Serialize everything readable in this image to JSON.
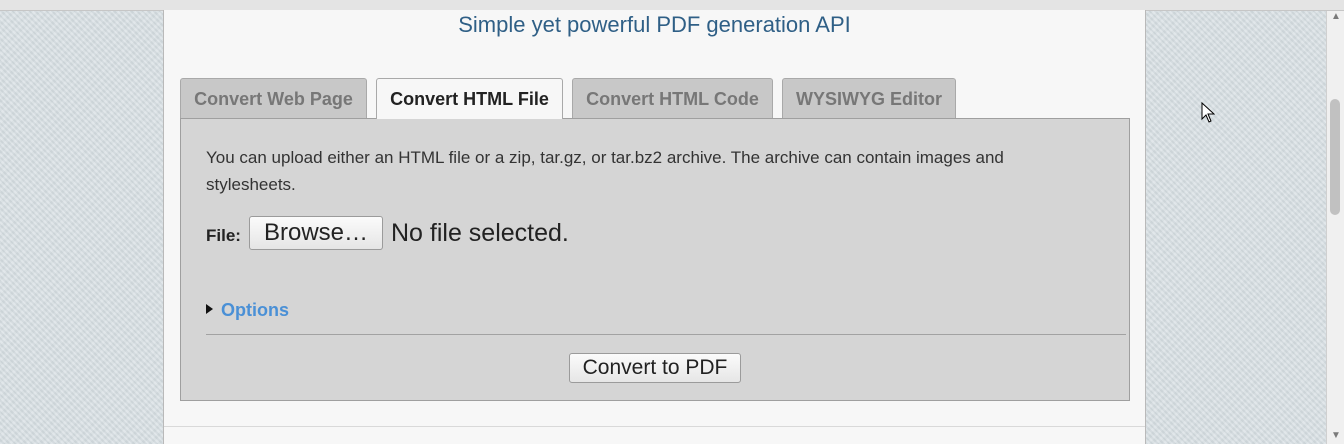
{
  "header": {
    "subtitle": "Simple yet powerful PDF generation API"
  },
  "tabs": [
    {
      "label": "Convert Web Page",
      "active": false
    },
    {
      "label": "Convert HTML File",
      "active": true
    },
    {
      "label": "Convert HTML Code",
      "active": false
    },
    {
      "label": "WYSIWYG Editor",
      "active": false
    }
  ],
  "panel": {
    "description": "You can upload either an HTML file or a zip, tar.gz, or tar.bz2 archive. The archive can contain images and stylesheets.",
    "file_label": "File:",
    "browse_label": "Browse…",
    "file_status": "No file selected.",
    "options_label": "Options",
    "convert_label": "Convert to PDF"
  },
  "colors": {
    "subtitle": "#2f5f86",
    "link": "#4a90d6",
    "panel_bg": "#d5d5d5",
    "tab_inactive_bg": "#c8c8c8"
  },
  "icons": {
    "options_toggle": "triangle-right-icon",
    "scroll_up": "scroll-up-arrow-icon",
    "scroll_down": "scroll-down-arrow-icon",
    "mouse_cursor": "mouse-cursor-icon"
  }
}
